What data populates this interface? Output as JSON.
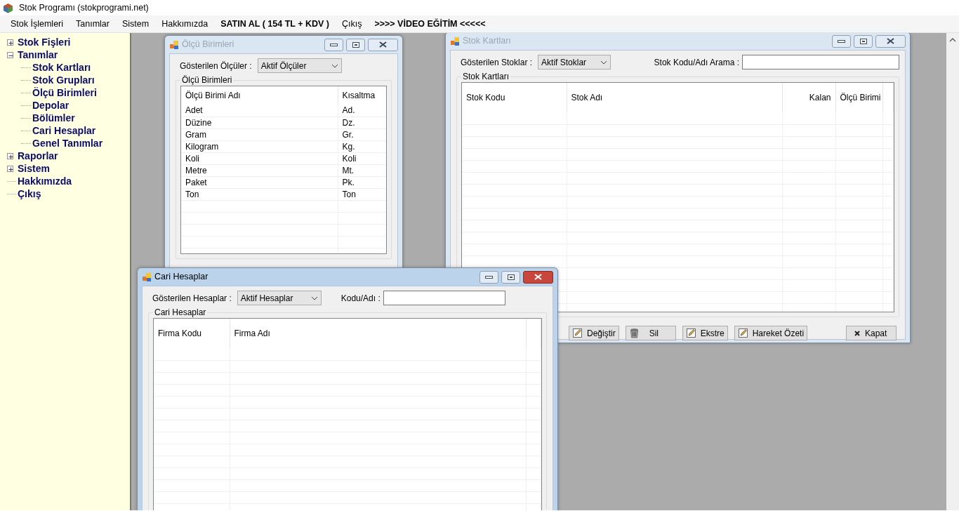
{
  "window": {
    "title": "Stok Programı (stokprogrami.net)"
  },
  "menu": [
    {
      "label": "Stok İşlemleri",
      "bold": false
    },
    {
      "label": "Tanımlar",
      "bold": false
    },
    {
      "label": "Sistem",
      "bold": false
    },
    {
      "label": "Hakkımızda",
      "bold": false
    },
    {
      "label": "SATIN AL ( 154 TL + KDV )",
      "bold": true
    },
    {
      "label": "Çıkış",
      "bold": false
    },
    {
      "label": ">>>> VİDEO EĞİTİM <<<<<",
      "bold": true
    }
  ],
  "tree": [
    {
      "label": "Stok Fişleri",
      "kind": "group",
      "expanded": false
    },
    {
      "label": "Tanımlar",
      "kind": "group",
      "expanded": true,
      "children": [
        {
          "label": "Stok Kartları",
          "kind": "item"
        },
        {
          "label": "Stok Grupları",
          "kind": "item"
        },
        {
          "label": "Ölçü Birimleri",
          "kind": "item"
        },
        {
          "label": "Depolar",
          "kind": "item"
        },
        {
          "label": "Bölümler",
          "kind": "item"
        },
        {
          "label": "Cari Hesaplar",
          "kind": "item"
        },
        {
          "label": "Genel Tanımlar",
          "kind": "item"
        }
      ]
    },
    {
      "label": "Raporlar",
      "kind": "group",
      "expanded": false
    },
    {
      "label": "Sistem",
      "kind": "group",
      "expanded": false
    },
    {
      "label": "Hakkımızda",
      "kind": "item"
    },
    {
      "label": "Çıkış",
      "kind": "item"
    }
  ],
  "mdi_windows": [
    {
      "title": "Ölçü Birimleri",
      "active": false,
      "filter": {
        "label": "Gösterilen Ölçüler :",
        "value": "Aktif Ölçüler"
      },
      "group_title": "Ölçü Birimleri",
      "columns": [
        "Ölçü Birimi Adı",
        "Kısaltma"
      ],
      "rows": [
        [
          "Adet",
          "Ad."
        ],
        [
          "Düzine",
          "Dz."
        ],
        [
          "Gram",
          "Gr."
        ],
        [
          "Kilogram",
          "Kg."
        ],
        [
          "Koli",
          "Koli"
        ],
        [
          "Metre",
          "Mt."
        ],
        [
          "Paket",
          "Pk."
        ],
        [
          "Ton",
          "Ton"
        ]
      ]
    },
    {
      "title": "Cari Hesaplar",
      "active": true,
      "filter": {
        "label": "Gösterilen Hesaplar :",
        "value": "Aktif Hesaplar"
      },
      "search": {
        "label": "Kodu/Adı :"
      },
      "group_title": "Cari Hesaplar",
      "columns": [
        "Firma Kodu",
        "Firma Adı"
      ]
    },
    {
      "title": "Stok Kartları",
      "active": false,
      "filter": {
        "label": "Gösterilen Stoklar :",
        "value": "Aktif Stoklar"
      },
      "search": {
        "label": "Stok Kodu/Adı Arama :"
      },
      "group_title": "Stok Kartları",
      "columns": [
        "Stok Kodu",
        "Stok Adı",
        "Kalan",
        "Ölçü Birimi"
      ],
      "buttons": [
        {
          "label": "Değiştir",
          "kind": "edit"
        },
        {
          "label": "Sil",
          "kind": "delete"
        },
        {
          "label": "Ekstre",
          "kind": "edit"
        },
        {
          "label": "Hareket Özeti",
          "kind": "edit"
        },
        {
          "label": "Kapat",
          "kind": "close"
        }
      ]
    }
  ]
}
